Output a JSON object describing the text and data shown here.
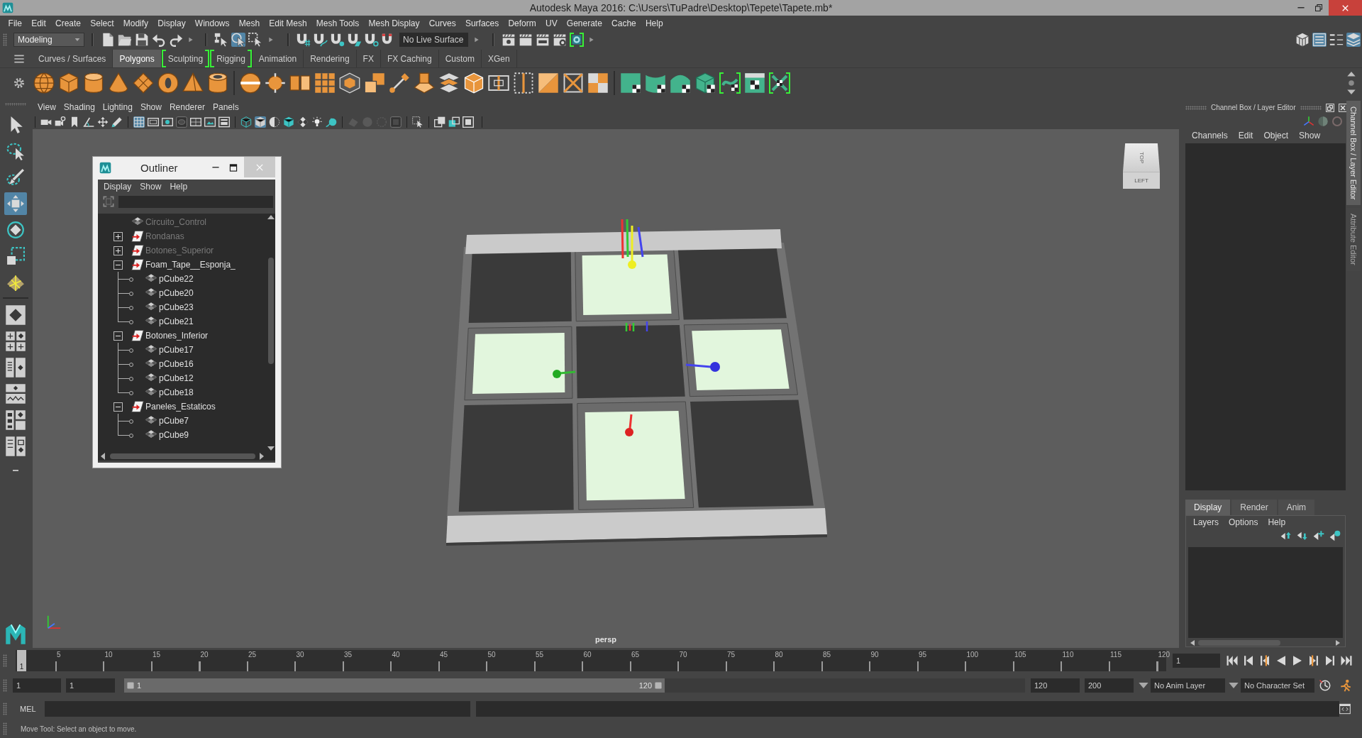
{
  "window": {
    "title": "Autodesk Maya 2016: C:\\Users\\TuPadre\\Desktop\\Tepete\\Tapete.mb*"
  },
  "menu_bar": [
    "File",
    "Edit",
    "Create",
    "Select",
    "Modify",
    "Display",
    "Windows",
    "Mesh",
    "Edit Mesh",
    "Mesh Tools",
    "Mesh Display",
    "Curves",
    "Surfaces",
    "Deform",
    "UV",
    "Generate",
    "Cache",
    "Help"
  ],
  "status_line": {
    "menu_set": "Modeling",
    "select_modes": [
      {
        "on": false
      },
      {
        "on": true
      },
      {
        "on": false
      }
    ],
    "live_surface": "No Live Surface",
    "render_tools": [
      {
        "highlight_new": false
      },
      {
        "highlight_new": false
      },
      {
        "highlight_new": false
      },
      {
        "highlight_new": false
      },
      {
        "highlight_new": true
      }
    ],
    "panel_toggles": [
      {
        "on": false
      },
      {
        "on": true
      },
      {
        "on": false
      },
      {
        "on": true
      }
    ]
  },
  "shelf": {
    "tabs": [
      {
        "label": "Curves / Surfaces",
        "selected": false,
        "highlight_new": false
      },
      {
        "label": "Polygons",
        "selected": true,
        "highlight_new": false
      },
      {
        "label": "Sculpting",
        "selected": false,
        "highlight_new": true
      },
      {
        "label": "Rigging",
        "selected": false,
        "highlight_new": true
      },
      {
        "label": "Animation",
        "selected": false,
        "highlight_new": false
      },
      {
        "label": "Rendering",
        "selected": false,
        "highlight_new": false
      },
      {
        "label": "FX",
        "selected": false,
        "highlight_new": false
      },
      {
        "label": "FX Caching",
        "selected": false,
        "highlight_new": false
      },
      {
        "label": "Custom",
        "selected": false,
        "highlight_new": false
      },
      {
        "label": "XGen",
        "selected": false,
        "highlight_new": false
      }
    ],
    "tools": [
      {
        "highlight_new": false
      },
      {
        "highlight_new": false
      },
      {
        "highlight_new": false
      },
      {
        "highlight_new": false
      },
      {
        "highlight_new": false
      },
      {
        "highlight_new": false
      },
      {
        "highlight_new": false
      },
      {
        "highlight_new": false
      },
      {
        "highlight_new": false
      },
      {
        "highlight_new": false
      },
      {
        "highlight_new": false
      },
      {
        "highlight_new": false
      },
      {
        "highlight_new": false
      },
      {
        "highlight_new": false
      },
      {
        "highlight_new": false
      },
      {
        "highlight_new": false
      },
      {
        "highlight_new": false
      },
      {
        "highlight_new": false
      },
      {
        "highlight_new": false
      },
      {
        "highlight_new": false
      },
      {
        "highlight_new": false
      },
      {
        "highlight_new": false
      },
      {
        "highlight_new": false
      },
      {
        "highlight_new": false
      },
      {
        "highlight_new": false
      },
      {
        "highlight_new": false
      },
      {
        "highlight_new": false
      },
      {
        "highlight_new": true
      },
      {
        "highlight_new": false
      },
      {
        "highlight_new": true
      }
    ]
  },
  "toolbox": {
    "tools": [
      {
        "selected": false
      },
      {
        "selected": false
      },
      {
        "selected": false
      },
      {
        "selected": true
      },
      {
        "selected": false
      },
      {
        "selected": false
      },
      {
        "selected": false
      }
    ]
  },
  "viewport": {
    "menu": [
      "View",
      "Shading",
      "Lighting",
      "Show",
      "Renderer",
      "Panels"
    ],
    "toolbar": [
      {
        "on": false,
        "disabled": false
      },
      {
        "on": false,
        "disabled": false
      },
      {
        "on": false,
        "disabled": false
      },
      {
        "on": false,
        "disabled": false
      },
      {
        "on": false,
        "disabled": false
      },
      {
        "on": false,
        "disabled": false
      },
      {
        "on": true,
        "disabled": false
      },
      {
        "on": false,
        "disabled": false
      },
      {
        "on": false,
        "disabled": false
      },
      {
        "on": false,
        "disabled": false
      },
      {
        "on": false,
        "disabled": false
      },
      {
        "on": false,
        "disabled": false
      },
      {
        "on": false,
        "disabled": false
      },
      {
        "on": false,
        "disabled": false
      },
      {
        "on": true,
        "disabled": false
      },
      {
        "on": false,
        "disabled": false
      },
      {
        "on": false,
        "disabled": false
      },
      {
        "on": false,
        "disabled": false
      },
      {
        "on": false,
        "disabled": false
      },
      {
        "on": false,
        "disabled": false
      },
      {
        "on": false,
        "disabled": true
      },
      {
        "on": false,
        "disabled": true
      },
      {
        "on": false,
        "disabled": true
      },
      {
        "on": false,
        "disabled": false
      },
      {
        "on": false,
        "disabled": false
      },
      {
        "on": false,
        "disabled": false
      },
      {
        "on": false,
        "disabled": false
      },
      {
        "on": false,
        "disabled": false
      }
    ],
    "view_cube": {
      "top": "TOP",
      "front": "LEFT"
    },
    "camera": "persp"
  },
  "outliner": {
    "title": "Outliner",
    "menu": [
      "Display",
      "Show",
      "Help"
    ],
    "items": [
      {
        "name": "Circuito_Control",
        "kind": "mesh",
        "hidden": true
      },
      {
        "name": "Rondanas",
        "kind": "group",
        "expanded": false,
        "hidden": true
      },
      {
        "name": "Botones_Superior",
        "kind": "group",
        "expanded": false,
        "hidden": true
      },
      {
        "name": "Foam_Tape__Esponja_",
        "kind": "group",
        "expanded": true,
        "hidden": false,
        "children": [
          {
            "name": "pCube22",
            "kind": "mesh",
            "hidden": false
          },
          {
            "name": "pCube20",
            "kind": "mesh",
            "hidden": false
          },
          {
            "name": "pCube23",
            "kind": "mesh",
            "hidden": false
          },
          {
            "name": "pCube21",
            "kind": "mesh",
            "hidden": false
          }
        ]
      },
      {
        "name": "Botones_Inferior",
        "kind": "group",
        "expanded": true,
        "hidden": false,
        "children": [
          {
            "name": "pCube17",
            "kind": "mesh",
            "hidden": false
          },
          {
            "name": "pCube16",
            "kind": "mesh",
            "hidden": false
          },
          {
            "name": "pCube12",
            "kind": "mesh",
            "hidden": false
          },
          {
            "name": "pCube18",
            "kind": "mesh",
            "hidden": false
          }
        ]
      },
      {
        "name": "Paneles_Estaticos",
        "kind": "group",
        "expanded": true,
        "hidden": false,
        "children": [
          {
            "name": "pCube7",
            "kind": "mesh",
            "hidden": false
          },
          {
            "name": "pCube9",
            "kind": "mesh",
            "hidden": false
          }
        ]
      }
    ]
  },
  "channel_box": {
    "title": "Channel Box / Layer Editor",
    "menu": [
      "Channels",
      "Edit",
      "Object",
      "Show"
    ]
  },
  "layer_editor": {
    "tabs": [
      {
        "label": "Display",
        "selected": true
      },
      {
        "label": "Render",
        "selected": false
      },
      {
        "label": "Anim",
        "selected": false
      }
    ],
    "menu": [
      "Layers",
      "Options",
      "Help"
    ]
  },
  "side_tabs": [
    {
      "label": "Channel Box / Layer Editor",
      "selected": true
    },
    {
      "label": "Attribute Editor",
      "selected": false
    }
  ],
  "time_slider": {
    "ticks": [
      "5",
      "10",
      "15",
      "20",
      "25",
      "30",
      "35",
      "40",
      "45",
      "50",
      "55",
      "60",
      "65",
      "70",
      "75",
      "80",
      "85",
      "90",
      "95",
      "100",
      "105",
      "110",
      "115",
      "120"
    ],
    "current_frame": "1",
    "level": 0,
    "frame_field": "1"
  },
  "range_slider": {
    "start_time": "1",
    "playback_start": "1",
    "range_start": "1",
    "range_end": "120",
    "level": 0.6,
    "playback_end": "120",
    "end_time": "200",
    "anim_layer": "No Anim Layer",
    "character_set": "No Character Set"
  },
  "command_line": {
    "language": "MEL"
  },
  "help_line": "Move Tool: Select an object to move."
}
